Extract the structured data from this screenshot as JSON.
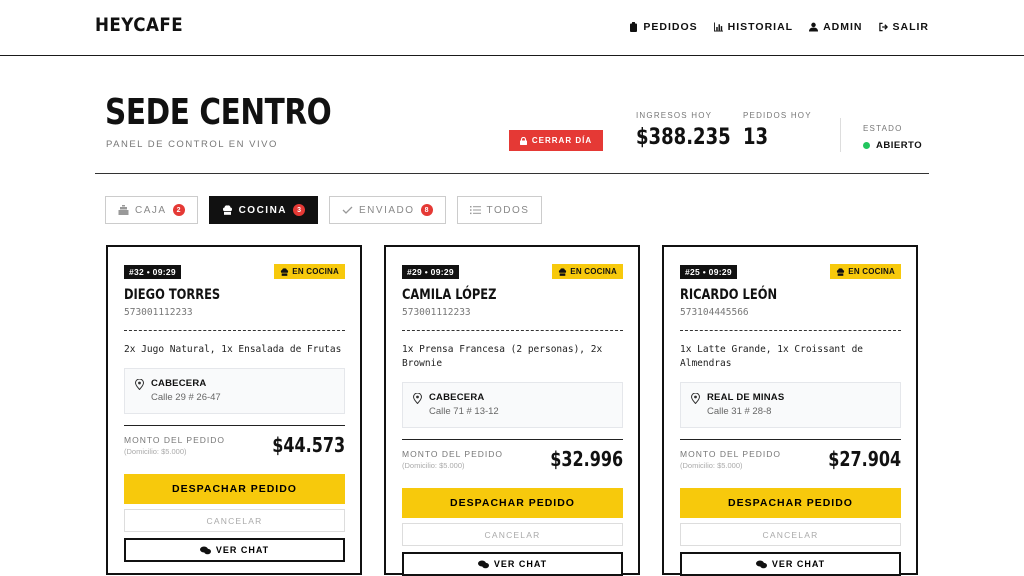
{
  "header": {
    "logo": "HEYCAFE",
    "nav": [
      {
        "label": "PEDIDOS",
        "icon": "clipboard-icon"
      },
      {
        "label": "HISTORIAL",
        "icon": "bar-chart-icon"
      },
      {
        "label": "ADMIN",
        "icon": "user-icon"
      },
      {
        "label": "SALIR",
        "icon": "sign-out-icon"
      }
    ]
  },
  "dashboard": {
    "title": "SEDE CENTRO",
    "subtitle": "PANEL DE CONTROL EN VIVO",
    "close_button": "CERRAR DÍA",
    "revenue_label": "INGRESOS HOY",
    "revenue_value": "$388.235",
    "orders_label": "PEDIDOS HOY",
    "orders_value": "13",
    "status_label": "ESTADO",
    "status_value": "ABIERTO",
    "status_color": "#22c55e"
  },
  "tabs": [
    {
      "label": "CAJA",
      "count": "2",
      "icon": "cash-register-icon"
    },
    {
      "label": "COCINA",
      "count": "3",
      "icon": "chef-icon"
    },
    {
      "label": "ENVIADO",
      "count": "8",
      "icon": "check-icon"
    },
    {
      "label": "TODOS",
      "count": "",
      "icon": "list-icon"
    }
  ],
  "labels": {
    "monto": "MONTO DEL PEDIDO",
    "despachar": "DESPACHAR PEDIDO",
    "cancelar": "CANCELAR",
    "ver_chat": "VER CHAT"
  },
  "orders": [
    {
      "tag": "#32 • 09:29",
      "status": "EN COCINA",
      "name": "DIEGO TORRES",
      "phone": "573001112233",
      "items": "2x Jugo Natural, 1x Ensalada de Frutas",
      "zone": "CABECERA",
      "address": "Calle 29 # 26-47",
      "delivery": "(Domicilio: $5.000)",
      "total": "$44.573"
    },
    {
      "tag": "#29 • 09:29",
      "status": "EN COCINA",
      "name": "CAMILA LÓPEZ",
      "phone": "573001112233",
      "items": "1x Prensa Francesa (2 personas), 2x Brownie",
      "zone": "CABECERA",
      "address": "Calle 71 # 13-12",
      "delivery": "(Domicilio: $5.000)",
      "total": "$32.996"
    },
    {
      "tag": "#25 • 09:29",
      "status": "EN COCINA",
      "name": "RICARDO LEÓN",
      "phone": "573104445566",
      "items": "1x Latte Grande, 1x Croissant de Almendras",
      "zone": "REAL DE MINAS",
      "address": "Calle 31 # 28-8",
      "delivery": "(Domicilio: $5.000)",
      "total": "$27.904"
    }
  ],
  "colors": {
    "accent": "#f7c90c",
    "danger": "#e53935",
    "ink": "#111111"
  }
}
